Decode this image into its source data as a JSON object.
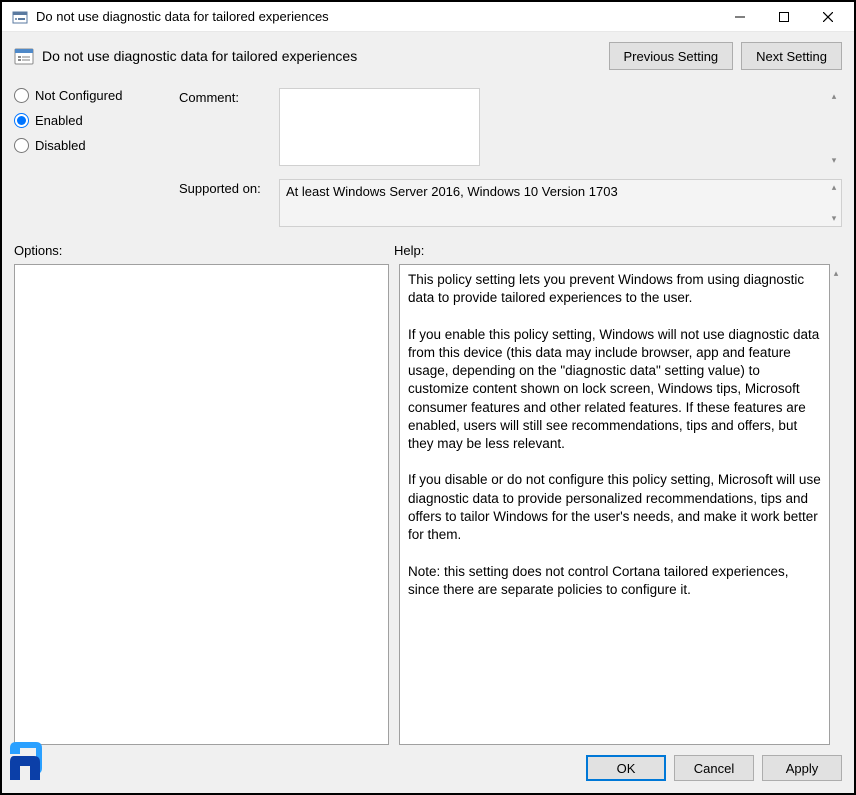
{
  "window": {
    "title": "Do not use diagnostic data for tailored experiences"
  },
  "header": {
    "policy_title": "Do not use diagnostic data for tailored experiences",
    "prev_label": "Previous Setting",
    "next_label": "Next Setting"
  },
  "state_radios": {
    "not_configured": "Not Configured",
    "enabled": "Enabled",
    "disabled": "Disabled",
    "selected": "enabled"
  },
  "fields": {
    "comment_label": "Comment:",
    "comment_value": "",
    "supported_label": "Supported on:",
    "supported_value": "At least Windows Server 2016, Windows 10 Version 1703"
  },
  "sections": {
    "options_label": "Options:",
    "help_label": "Help:"
  },
  "help_text": "This policy setting lets you prevent Windows from using diagnostic data to provide tailored experiences to the user.\n\nIf you enable this policy setting, Windows will not use diagnostic data from this device (this data may include browser, app and feature usage, depending on the \"diagnostic data\" setting value) to customize content shown on lock screen, Windows tips, Microsoft consumer features and other related features. If these features are enabled, users will still see recommendations, tips and offers, but they may be less relevant.\n\nIf you disable or do not configure this policy setting, Microsoft will use diagnostic data to provide personalized recommendations, tips and offers to tailor Windows for the user's needs, and make it work better for them.\n\nNote: this setting does not control Cortana tailored experiences, since there are separate policies to configure it.",
  "footer": {
    "ok": "OK",
    "cancel": "Cancel",
    "apply": "Apply"
  }
}
